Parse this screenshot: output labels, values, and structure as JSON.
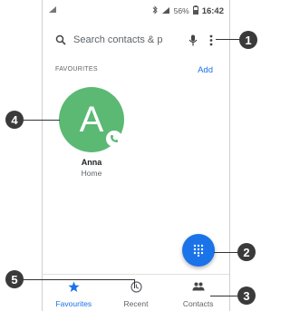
{
  "status_bar": {
    "left_icon": "signal-icon",
    "battery_percent": "56%",
    "time": "16:42"
  },
  "search": {
    "placeholder": "Search contacts & p"
  },
  "favourites": {
    "title": "FAVOURITES",
    "add_label": "Add",
    "contacts": [
      {
        "initial": "A",
        "name": "Anna",
        "type": "Home",
        "avatar_color": "#5bb974"
      }
    ]
  },
  "bottom_nav": {
    "items": [
      {
        "label": "Favourites",
        "icon": "star-icon",
        "active": true
      },
      {
        "label": "Recent",
        "icon": "clock-icon",
        "active": false
      },
      {
        "label": "Contacts",
        "icon": "people-icon",
        "active": false
      }
    ]
  },
  "callouts": [
    "1",
    "2",
    "3",
    "4",
    "5"
  ],
  "colors": {
    "accent": "#1a73e8",
    "avatar": "#5bb974",
    "callout": "#3a3a3a"
  }
}
